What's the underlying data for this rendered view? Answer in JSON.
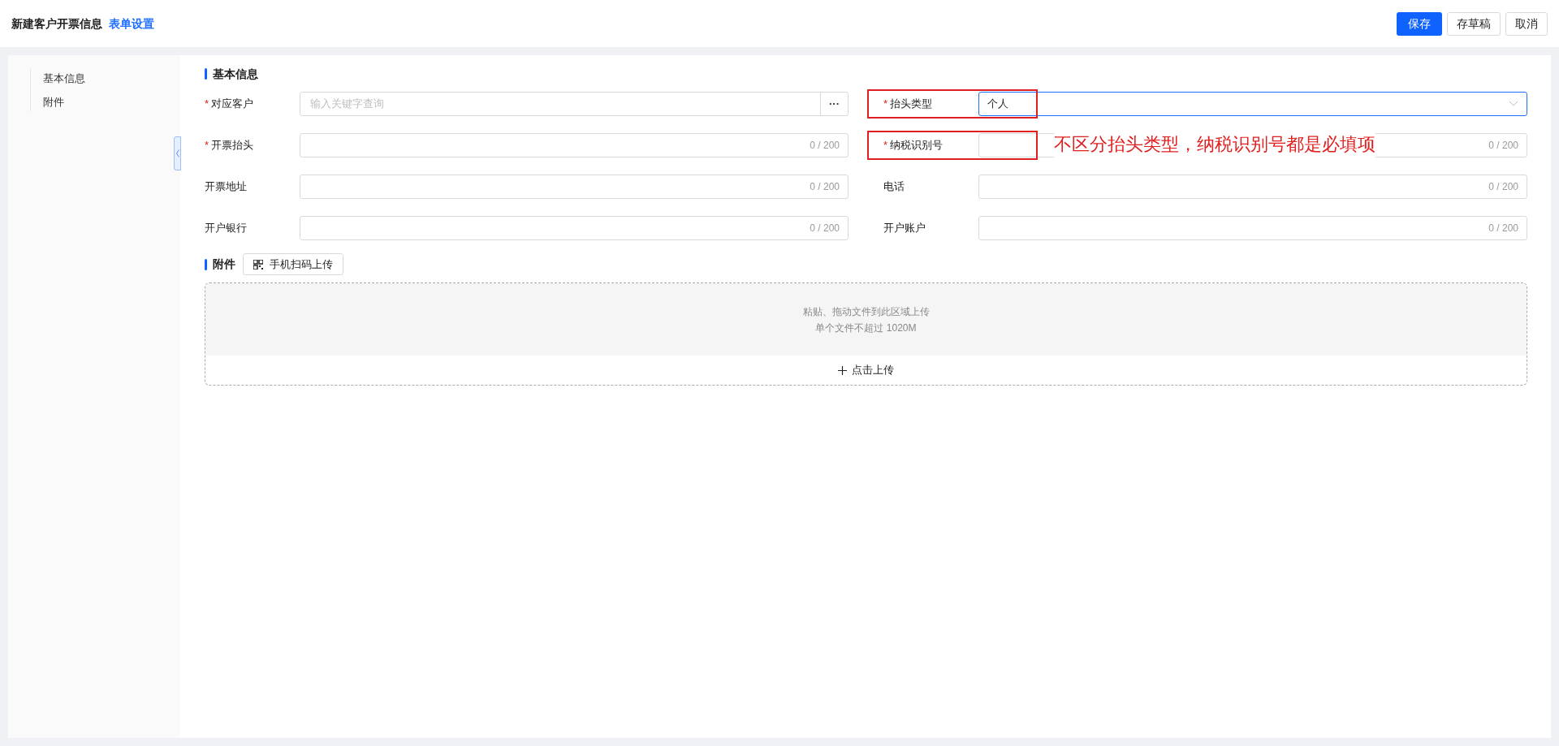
{
  "header": {
    "title": "新建客户开票信息",
    "link": "表单设置",
    "buttons": [
      {
        "label": "保存",
        "kind": "primary"
      },
      {
        "label": "存草稿",
        "kind": "default"
      },
      {
        "label": "取消",
        "kind": "default"
      }
    ]
  },
  "sidebar": {
    "items": [
      {
        "label": "基本信息"
      },
      {
        "label": "附件"
      }
    ]
  },
  "basic": {
    "title": "基本信息",
    "fields": [
      {
        "label": "对应客户",
        "required": "*",
        "kind": "lookup",
        "placeholder": "输入关键字查询",
        "button": "···",
        "highlighted": false
      },
      {
        "label": "抬头类型",
        "required": "*",
        "kind": "select",
        "value": "个人",
        "highlighted": true
      },
      {
        "label": "开票抬头",
        "required": "*",
        "kind": "text",
        "counter": "0 / 200",
        "highlighted": false
      },
      {
        "label": "纳税识别号",
        "required": "*",
        "kind": "text",
        "counter": "0 / 200",
        "highlighted": true,
        "note": "不区分抬头类型，纳税识别号都是必填项"
      },
      {
        "label": "开票地址",
        "kind": "text",
        "counter": "0 / 200",
        "highlighted": false
      },
      {
        "label": "电话",
        "kind": "text",
        "counter": "0 / 200",
        "highlighted": false
      },
      {
        "label": "开户银行",
        "kind": "text",
        "counter": "0 / 200",
        "highlighted": false
      },
      {
        "label": "开户账户",
        "kind": "text",
        "counter": "0 / 200",
        "highlighted": false
      }
    ]
  },
  "attachments": {
    "title": "附件",
    "scan_button": "手机扫码上传",
    "drop_hint": "粘贴、拖动文件到此区域上传",
    "size_hint": "单个文件不超过 1020M",
    "upload_button": "点击上传"
  }
}
